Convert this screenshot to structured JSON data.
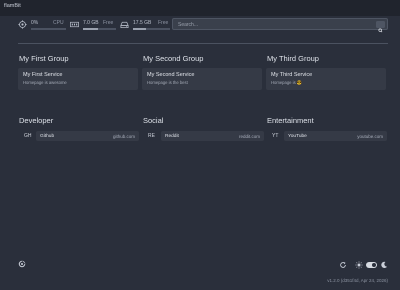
{
  "window": {
    "title": "flamBit"
  },
  "resources": {
    "cpu": {
      "value": "0%",
      "label": "CPU",
      "icon": "cpu-icon",
      "fraction": 0.0
    },
    "memory": {
      "value": "7.0 GB",
      "label": "Free",
      "icon": "memory-icon",
      "fraction": 0.45
    },
    "disk": {
      "value": "17.5 GB",
      "label": "Free",
      "icon": "disk-icon",
      "fraction": 0.35
    }
  },
  "search": {
    "placeholder": "Search...",
    "button_icon": "search-icon"
  },
  "service_groups": [
    {
      "title": "My First Group",
      "service": {
        "name": "My First Service",
        "description": "Homepage is awesome"
      }
    },
    {
      "title": "My Second Group",
      "service": {
        "name": "My Second Service",
        "description": "Homepage is the best"
      }
    },
    {
      "title": "My Third Group",
      "service": {
        "name": "My Third Service",
        "description": "Homepage is 😎"
      }
    }
  ],
  "bookmark_groups": [
    {
      "title": "Developer",
      "bookmark": {
        "abbr": "GH",
        "name": "Github",
        "url": "github.com"
      }
    },
    {
      "title": "Social",
      "bookmark": {
        "abbr": "RE",
        "name": "Reddit",
        "url": "reddit.com"
      }
    },
    {
      "title": "Entertainment",
      "bookmark": {
        "abbr": "YT",
        "name": "YouTube",
        "url": "youtube.com"
      }
    }
  ],
  "footer": {
    "version": "v1.2.0 (d351f4d, Apr 24, 2026)",
    "icons": [
      "homepage-logo-icon",
      "refresh-icon",
      "sun-icon",
      "theme-toggle",
      "moon-icon"
    ]
  },
  "colors": {
    "background": "#2a2f3b",
    "card": "#353a46",
    "text": "#d4d8e0"
  }
}
